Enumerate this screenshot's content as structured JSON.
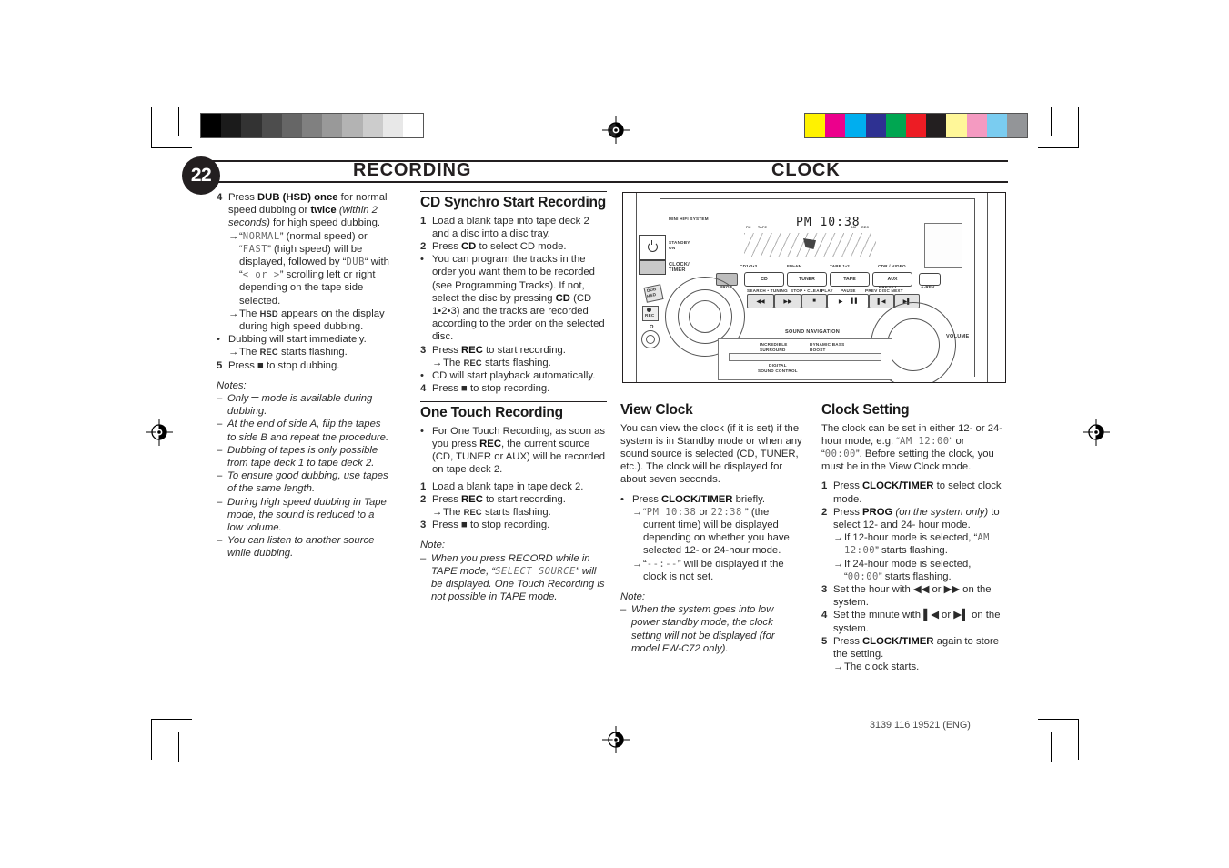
{
  "header": {
    "page_number": "22",
    "left_title": "RECORDING",
    "right_title": "CLOCK"
  },
  "footer": {
    "doc_code": "3139 116 19521 (ENG)"
  },
  "column1": {
    "step4": {
      "marker": "4",
      "t1": "Press ",
      "b1": "DUB (HSD) once",
      "t2": " for normal speed dubbing or ",
      "b2": "twice",
      "t3": " ",
      "i1": "(within 2 seconds)",
      "t4": " for high speed dubbing."
    },
    "arrow1": {
      "marker": "→",
      "t1": "“",
      "lcd1": "NORMAL",
      "t2": "” (normal speed) or “",
      "lcd2": "FAST",
      "t3": "” (high speed) will be displayed, followed by “",
      "lcd3": "DUB",
      "t4": "“ with “",
      "lcd4": "< or >",
      "t5": "” scrolling left or right depending on the tape side selected."
    },
    "arrow2": {
      "marker": "→",
      "t1": "The ",
      "sc": "HSD",
      "t2": " appears on the display during high speed dubbing."
    },
    "bullet1": {
      "marker": "•",
      "text": "Dubbing will start immediately."
    },
    "arrow3": {
      "marker": "→",
      "t1": "The ",
      "sc": "REC",
      "t2": " starts flashing."
    },
    "step5": {
      "marker": "5",
      "t1": "Press ",
      "icon": "■",
      "t2": " to stop dubbing."
    },
    "notes_label": "Notes:",
    "notes": [
      "Only ═ mode is available during dubbing.",
      "At the end of side A, flip the tapes to side B and repeat the procedure.",
      "Dubbing of tapes is only possible from tape deck 1 to tape deck 2.",
      "To ensure good dubbing, use tapes of the same length.",
      "During high speed dubbing in Tape mode, the sound is reduced to a low volume.",
      "You can listen to another source while dubbing."
    ]
  },
  "column2": {
    "heading": "CD Synchro Start Recording",
    "step1": {
      "marker": "1",
      "text": "Load a blank tape into tape deck 2 and a disc into a disc tray."
    },
    "step2": {
      "marker": "2",
      "t1": "Press ",
      "b1": "CD",
      "t2": " to select CD mode."
    },
    "bullet1": {
      "marker": "•",
      "t1": "You can program the tracks in the order you want them to be recorded (see Programming Tracks). If not, select the disc by pressing ",
      "b1": "CD",
      "t2": " (CD 1•2•3) and the tracks are recorded according to the order on the selected disc."
    },
    "step3": {
      "marker": "3",
      "t1": "Press ",
      "b1": "REC",
      "t2": " to start recording."
    },
    "arrow1": {
      "marker": "→",
      "t1": "The ",
      "sc": "REC",
      "t2": " starts flashing."
    },
    "bullet2": {
      "marker": "•",
      "text": "CD will start playback automatically."
    },
    "step4": {
      "marker": "4",
      "t1": "Press ",
      "icon": "■",
      "t2": " to stop recording."
    },
    "heading2": "One Touch Recording",
    "otr_bullet": {
      "marker": "•",
      "t1": "For One Touch Recording, as soon as you press ",
      "b1": "REC",
      "t2": ", the current source (CD, TUNER or AUX) will be recorded on tape deck 2."
    },
    "otr_step1": {
      "marker": "1",
      "text": "Load a blank tape in tape deck 2."
    },
    "otr_step2": {
      "marker": "2",
      "t1": "Press ",
      "b1": "REC",
      "t2": " to start recording."
    },
    "otr_arrow": {
      "marker": "→",
      "t1": "The ",
      "sc": "REC",
      "t2": " starts flashing."
    },
    "otr_step3": {
      "marker": "3",
      "t1": "Press ",
      "icon": "■",
      "t2": " to stop recording."
    },
    "note_label": "Note:",
    "note": {
      "marker": "–",
      "t1": "When you press RECORD while in TAPE mode, “",
      "lcd": "SELECT SOURCE",
      "t2": "” will be displayed.  One Touch Recording is not possible in TAPE mode."
    }
  },
  "column3": {
    "heading": "View Clock",
    "intro": "You can view the clock (if it is set) if the system is in Standby mode or when any sound source is selected (CD, TUNER, etc.). The clock will be displayed for about seven seconds.",
    "bullet": {
      "marker": "•",
      "t1": "Press ",
      "b1": "CLOCK/TIMER",
      "t2": " briefly."
    },
    "arrow1": {
      "marker": "→",
      "t1": "“",
      "lcd1": "PM  10:38",
      "t2": " or ",
      "lcd2": "22:38",
      "t3": " ” (the current time) will be displayed depending on whether you have selected  12- or 24-hour mode."
    },
    "arrow2": {
      "marker": "→",
      "t1": "“",
      "lcd1": "--:--",
      "t2": "” will be displayed if the clock is not set."
    },
    "note_label": "Note:",
    "note": {
      "marker": "–",
      "text": "When the system goes into low power standby mode, the clock setting will not be displayed (for model FW-C72 only)."
    }
  },
  "column4": {
    "heading": "Clock Setting",
    "intro_t1": "The clock can be set in either 12- or 24-hour mode, e.g. “",
    "intro_lcd1": "AM  12:00",
    "intro_t2": "“ or “",
    "intro_lcd2": "00:00",
    "intro_t3": "”. Before setting the clock, you must be in the View Clock mode.",
    "step1": {
      "marker": "1",
      "t1": "Press ",
      "b1": "CLOCK/TIMER",
      "t2": " to select clock mode."
    },
    "step2": {
      "marker": "2",
      "t1": "Press ",
      "b1": "PROG",
      "i1": " (on the system only)",
      "t2": " to select 12- and 24- hour mode."
    },
    "arrow1": {
      "marker": "→",
      "t1": "If 12-hour mode is selected, “",
      "lcd": "AM 12:00",
      "t2": "” starts flashing."
    },
    "arrow2": {
      "marker": "→",
      "t1": "If 24-hour mode is selected, “",
      "lcd": "00:00",
      "t2": "” starts flashing."
    },
    "step3": {
      "marker": "3",
      "t1": "Set the hour with ",
      "ic1": "◀◀",
      "t2": " or ",
      "ic2": "▶▶",
      "t3": " on the system."
    },
    "step4": {
      "marker": "4",
      "t1": "Set the minute with ",
      "ic1": "▌◀",
      "t2": " or ",
      "ic2": "▶▌",
      "t3": " on the system."
    },
    "step5": {
      "marker": "5",
      "t1": "Press ",
      "b1": "CLOCK/TIMER",
      "t2": " again to store the setting."
    },
    "arrow3": {
      "marker": "→",
      "text": "The clock starts."
    }
  },
  "diagram": {
    "brand": "MINI HIFI SYSTEM",
    "standby": "STANDBY",
    "standby2": "ON",
    "clock_timer": "CLOCK/",
    "clock_timer2": "TIMER",
    "dub": "DUB",
    "dub2": "HSD",
    "rec": "REC",
    "prog": "PROG",
    "display_time": "PM 10:38",
    "source_labels": [
      "CD1•2•3",
      "FM•AM",
      "TAPE 1•2",
      "CDR / VIDEO"
    ],
    "source_buttons": [
      "CD",
      "TUNER",
      "TAPE",
      "AUX"
    ],
    "a_rev": "A-REV",
    "transport_labels": [
      "SEARCH • TUNING",
      "STOP • CLEAR",
      "PLAY",
      "PAUSE",
      "PRESET",
      "PREV  DISC  NEXT"
    ],
    "transport_icons": [
      "◀◀",
      "▶▶",
      "■",
      "▶",
      "▐▐",
      "▌◀",
      "▶▌"
    ],
    "sound_navigation": "SOUND NAVIGATION",
    "incredible": "INCREDIBLE",
    "incredible2": "SURROUND",
    "dbb": "DYNAMIC BASS",
    "dbb2": "BOOST",
    "dsc": "DIGITAL",
    "dsc2": "SOUND CONTROL",
    "volume": "VOLUME"
  },
  "print_marks": {
    "gray_wedge": [
      "#000000",
      "#1b1b1b",
      "#333333",
      "#4d4d4d",
      "#666666",
      "#808080",
      "#999999",
      "#b3b3b3",
      "#cccccc",
      "#e8e8e8",
      "#ffffff"
    ],
    "color_bars": [
      "#fff200",
      "#ec008c",
      "#00aeef",
      "#2e3192",
      "#00a651",
      "#ed1c24",
      "#231f20",
      "#fff799",
      "#f49ac1",
      "#7accf0",
      "#939598"
    ]
  }
}
